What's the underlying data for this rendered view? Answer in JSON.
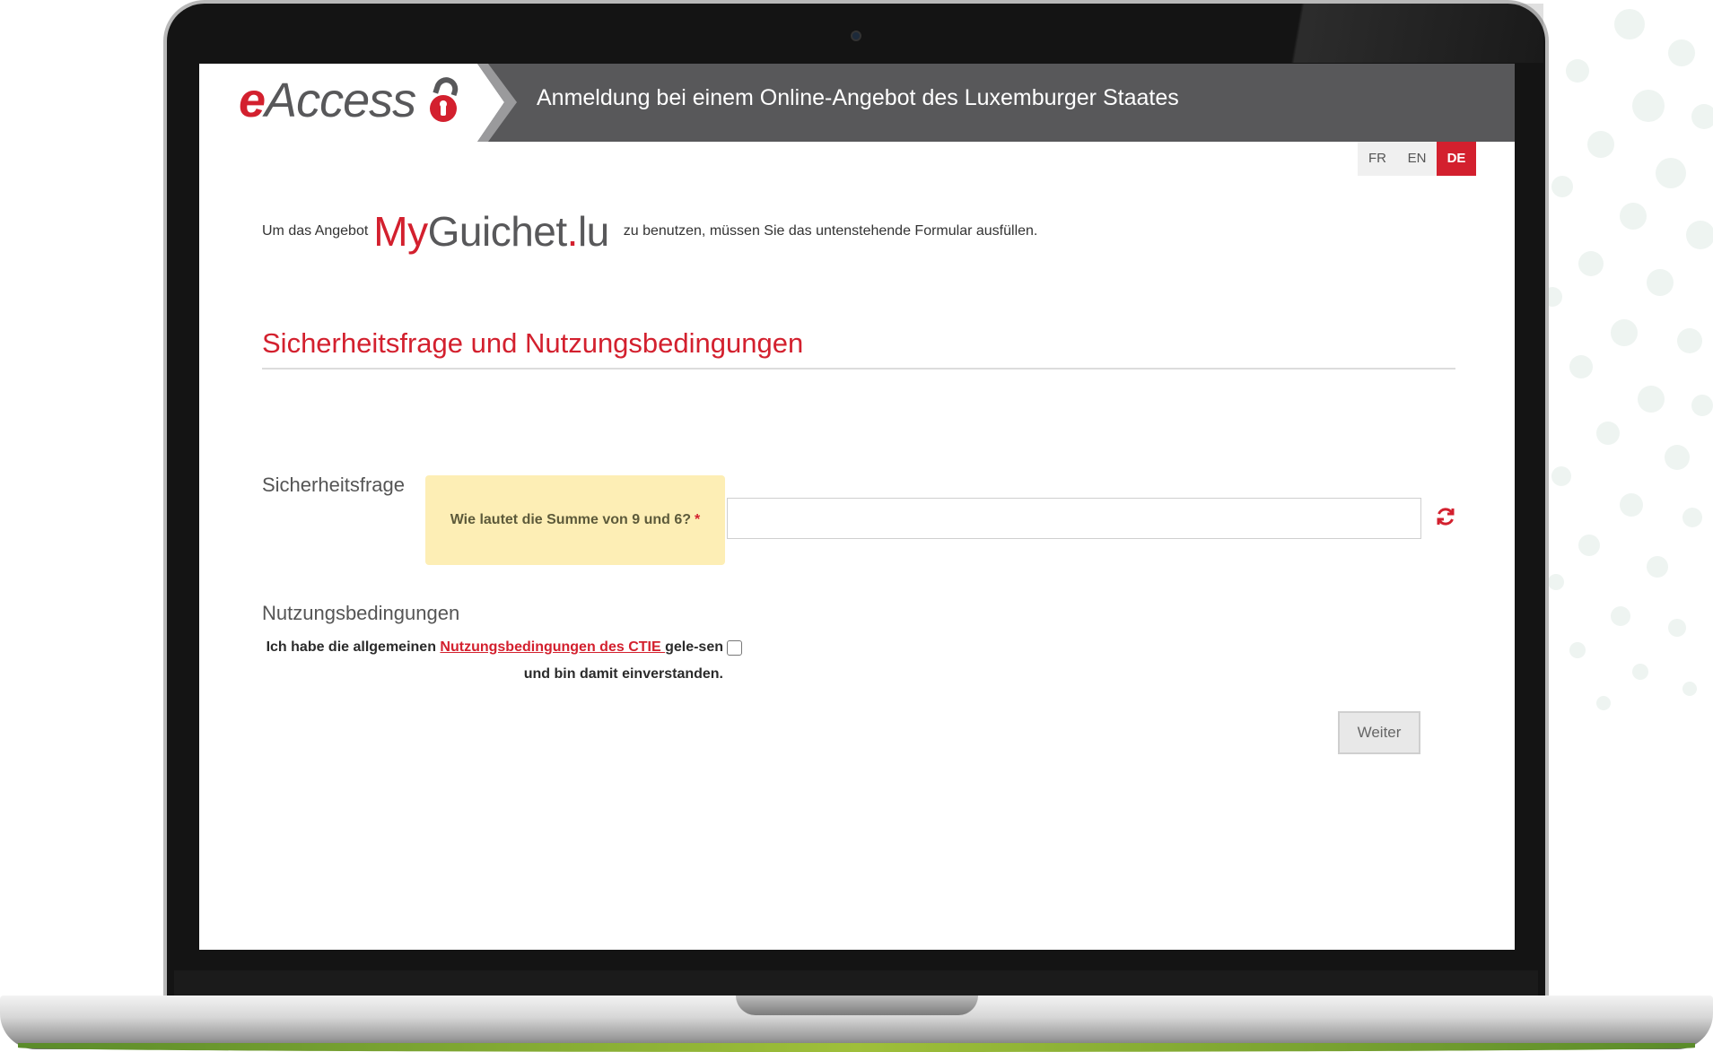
{
  "app": {
    "logo_text": "Access",
    "logo_e": "e",
    "header_title": "Anmeldung bei einem Online-Angebot des Luxemburger Staates"
  },
  "languages": [
    {
      "code": "FR",
      "active": false
    },
    {
      "code": "EN",
      "active": false
    },
    {
      "code": "DE",
      "active": true
    }
  ],
  "intro": {
    "prefix": "Um das Angebot",
    "brand_my": "My",
    "brand_guichet": "Guichet",
    "brand_dot": ".",
    "brand_lu": "lu",
    "suffix": "zu benutzen, müssen Sie das untenstehende Formular ausfüllen."
  },
  "section": {
    "title": "Sicherheitsfrage und Nutzungsbedingungen"
  },
  "security": {
    "label": "Sicherheitsfrage",
    "question": "Wie lautet die Summe von 9 und 6?",
    "required_mark": "*",
    "answer_value": "",
    "refresh_icon": "refresh-icon"
  },
  "terms": {
    "label": "Nutzungsbedingungen",
    "text_before": "Ich habe die allgemeinen ",
    "link_text": "Nutzungsbedingungen des CTIE ",
    "text_after": "gele-sen und bin damit einverstanden.",
    "checked": false
  },
  "actions": {
    "next_label": "Weiter"
  },
  "colors": {
    "accent": "#d3202e",
    "header_bg": "#58585a",
    "question_bg": "#fdeeb5"
  }
}
